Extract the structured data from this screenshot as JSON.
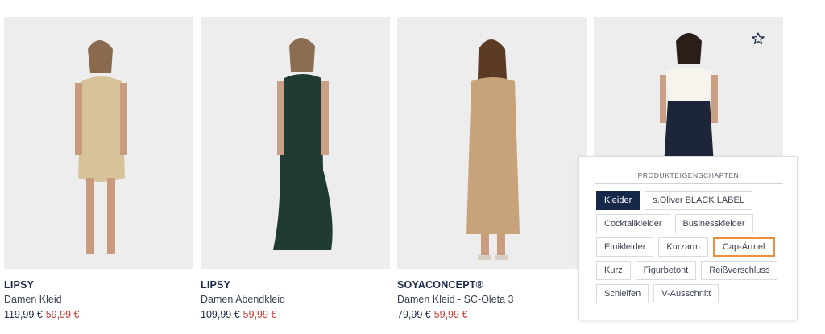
{
  "products": [
    {
      "brand": "LIPSY",
      "name": "Damen Kleid",
      "old_price": "119,99 €",
      "new_price": "59,99 €"
    },
    {
      "brand": "LIPSY",
      "name": "Damen Abendkleid",
      "old_price": "109,99 €",
      "new_price": "59,99 €"
    },
    {
      "brand": "SOYACONCEPT®",
      "name": "Damen Kleid - SC-Oleta 3",
      "old_price": "79,99 €",
      "new_price": "59,99 €"
    },
    {
      "brand": "",
      "name": "",
      "old_price": "",
      "new_price": ""
    }
  ],
  "wishlist_icon": "star-outline",
  "properties_panel": {
    "title": "PRODUKTEIGENSCHAFTEN",
    "tags": [
      {
        "label": "Kleider",
        "state": "active"
      },
      {
        "label": "s.Oliver BLACK LABEL",
        "state": "normal"
      },
      {
        "label": "Cocktailkleider",
        "state": "normal"
      },
      {
        "label": "Businesskleider",
        "state": "normal"
      },
      {
        "label": "Etuikleider",
        "state": "normal"
      },
      {
        "label": "Kurzarm",
        "state": "normal"
      },
      {
        "label": "Cap-Ärmel",
        "state": "highlighted"
      },
      {
        "label": "Kurz",
        "state": "normal"
      },
      {
        "label": "Figurbetont",
        "state": "normal"
      },
      {
        "label": "Reißverschluss",
        "state": "normal"
      },
      {
        "label": "Schleifen",
        "state": "normal"
      },
      {
        "label": "V-Ausschnitt",
        "state": "normal"
      }
    ]
  },
  "colors": {
    "brand_navy": "#16284a",
    "sale_red": "#d0342c",
    "highlight_orange": "#ef8f3c"
  }
}
